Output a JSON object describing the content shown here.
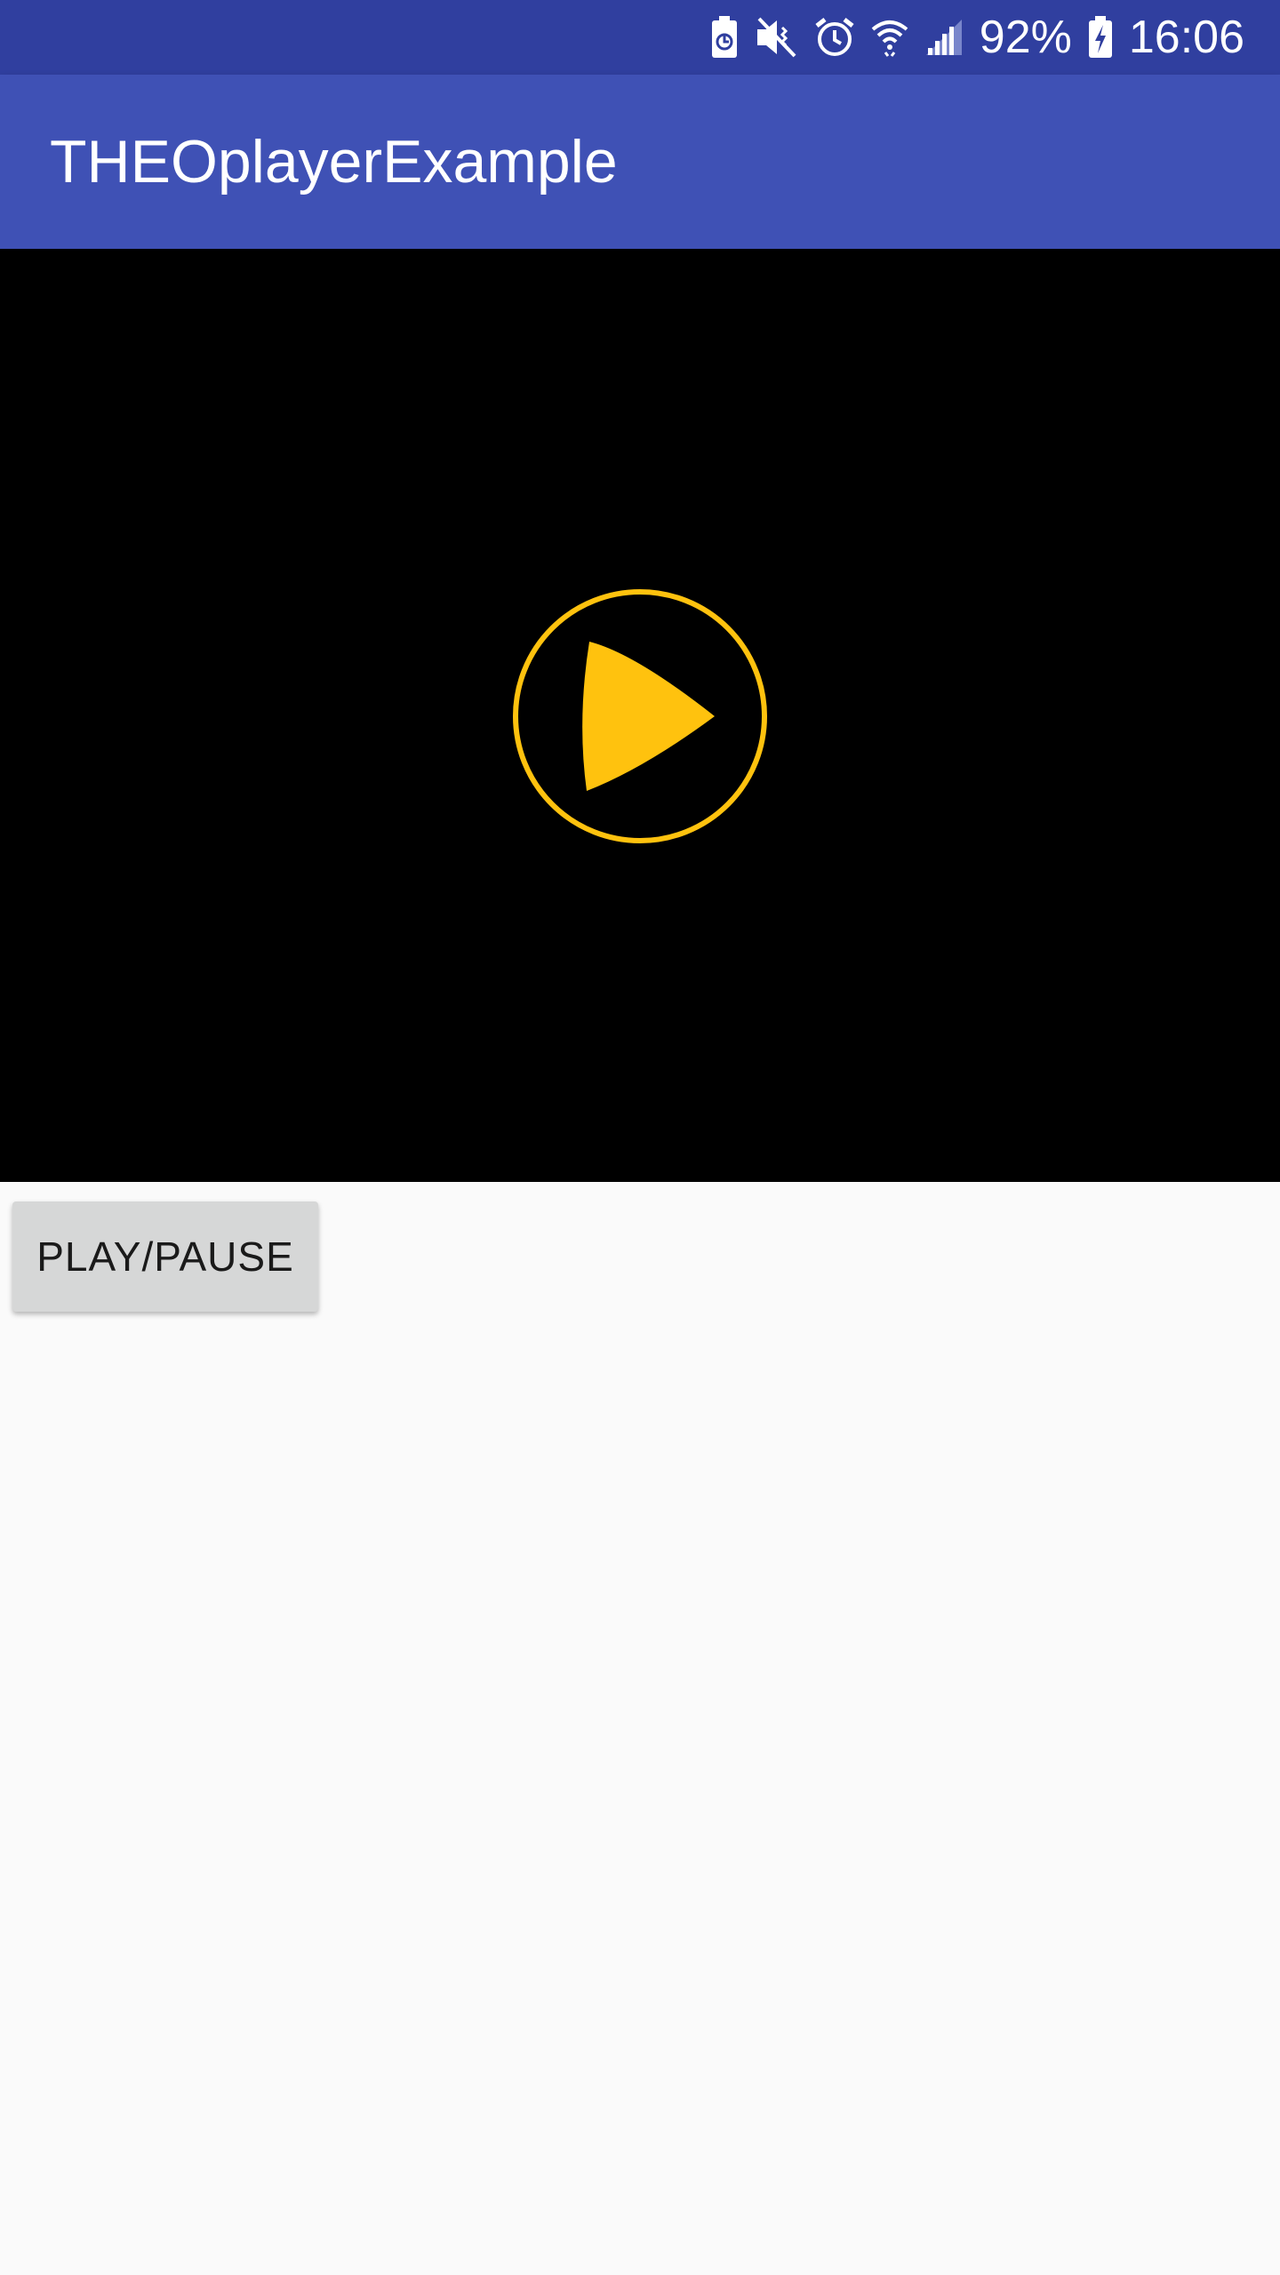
{
  "status_bar": {
    "battery_percent": "92%",
    "time": "16:06",
    "icons": [
      "battery-saver-icon",
      "mute-icon",
      "alarm-icon",
      "wifi-icon",
      "cell-signal-icon",
      "battery-charging-icon"
    ],
    "background_color": "#303f9f"
  },
  "app_bar": {
    "title": "THEOplayerExample",
    "background_color": "#3f51b5"
  },
  "player": {
    "background_color": "#000000",
    "overlay_icon": "play-icon",
    "accent_color": "#ffc20e"
  },
  "controls": {
    "play_pause_label": "PLAY/PAUSE"
  }
}
